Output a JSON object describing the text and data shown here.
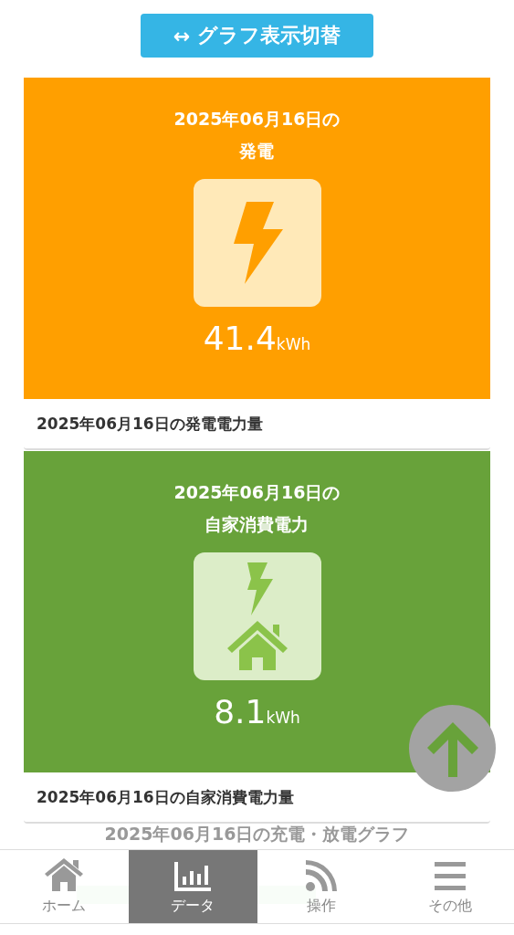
{
  "toggle_button": {
    "icon": "↔",
    "label": "グラフ表示切替"
  },
  "cards": [
    {
      "kind": "generation",
      "color": "#ff9f00",
      "title_lines": [
        "2025年06月16日の",
        "発電"
      ],
      "value": "41.4",
      "unit": "kWh",
      "caption": "2025年06月16日の発電電力量"
    },
    {
      "kind": "self_consumption",
      "color": "#68a23a",
      "title_lines": [
        "2025年06月16日の",
        "自家消費電力"
      ],
      "value": "8.1",
      "unit": "kWh",
      "caption": "2025年06月16日の自家消費電力量"
    }
  ],
  "chart_section": {
    "title": "2025年06月16日の充電・放電グラフ"
  },
  "nav": [
    {
      "label": "ホーム",
      "selected": false
    },
    {
      "label": "データ",
      "selected": true
    },
    {
      "label": "操作",
      "selected": false
    },
    {
      "label": "その他",
      "selected": false
    }
  ]
}
